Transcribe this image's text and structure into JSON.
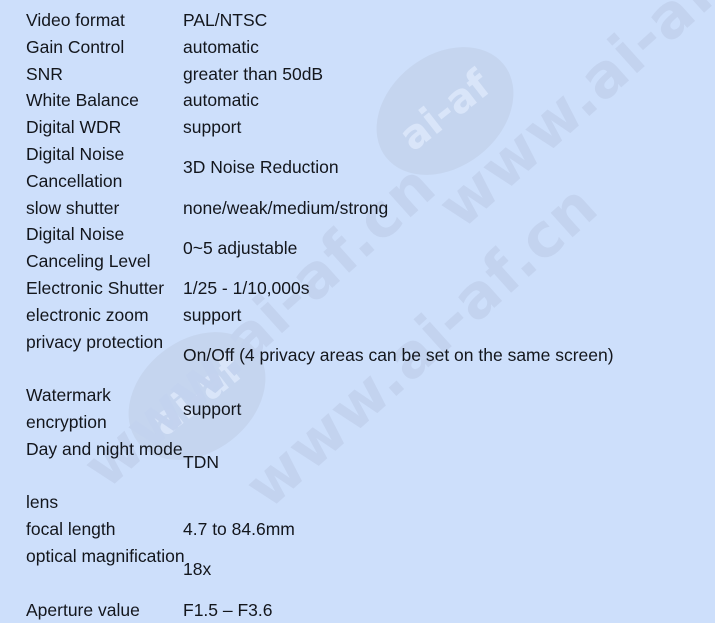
{
  "page": {
    "background_color": "#cddffb",
    "text_color": "#13161c",
    "watermark_color": "#c3d3ef"
  },
  "watermarks": {
    "badge_text": "ai-af",
    "domain_text": "www.ai-af.cn"
  },
  "spec_table": {
    "rows": [
      {
        "label": "Video format",
        "value": "PAL/NTSC"
      },
      {
        "label": "Gain Control",
        "value": "automatic"
      },
      {
        "label": "SNR",
        "value": "greater than 50dB"
      },
      {
        "label": "White Balance",
        "value": "automatic"
      },
      {
        "label": "Digital WDR",
        "value": "support"
      },
      {
        "label": "Digital Noise Cancellation",
        "value": "3D Noise Reduction"
      },
      {
        "label": "slow shutter",
        "value": "none/weak/medium/strong"
      },
      {
        "label": "Digital Noise Canceling Level",
        "value": "0~5 adjustable"
      },
      {
        "label": "Electronic Shutter",
        "value": "1/25 - 1/10,000s"
      },
      {
        "label": "electronic zoom",
        "value": "support"
      },
      {
        "label": "privacy protection",
        "value": "On/Off (4 privacy areas can be set on the same screen)"
      },
      {
        "label": "Watermark encryption",
        "value": "support"
      },
      {
        "label": "Day and night mode",
        "value": "TDN"
      },
      {
        "label": "lens",
        "value": ""
      },
      {
        "label": "focal length",
        "value": "4.7 to 84.6mm"
      },
      {
        "label": "optical magnification",
        "value": "18x"
      },
      {
        "label": "Aperture value",
        "value": "F1.5 – F3.6"
      }
    ]
  }
}
